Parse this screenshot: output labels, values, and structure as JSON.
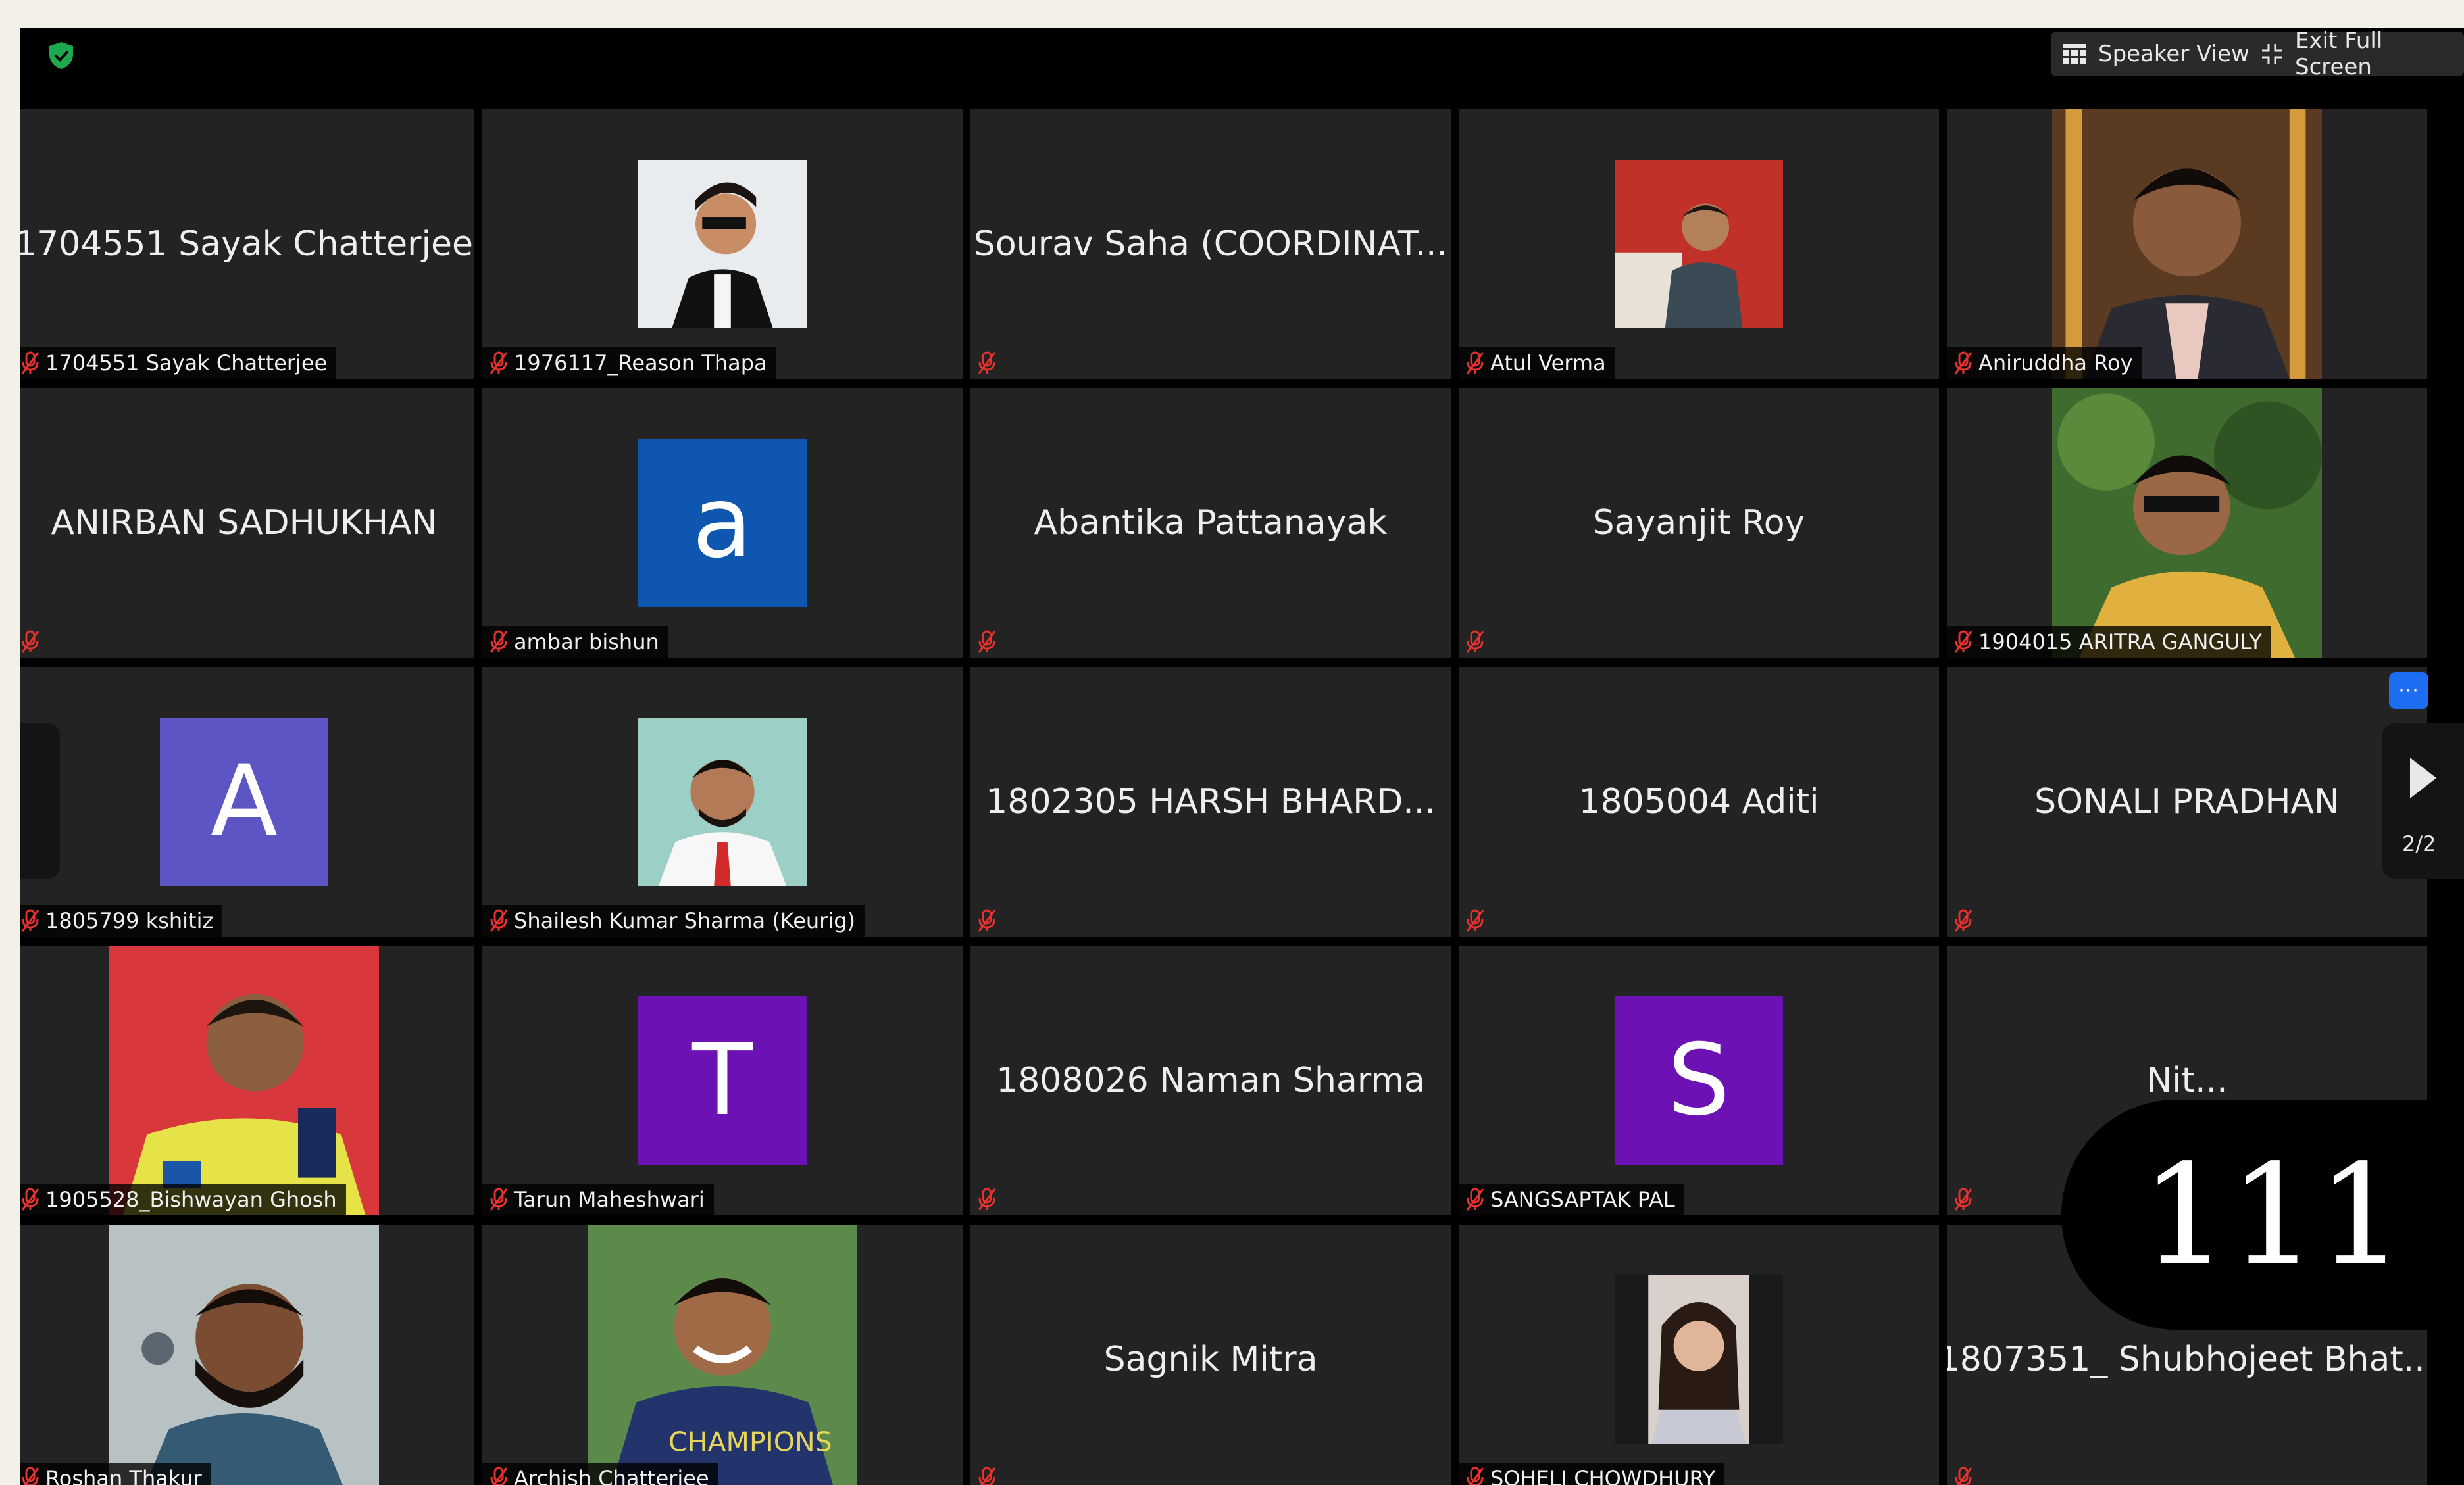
{
  "toolbar": {
    "speaker_view_label": "Speaker View",
    "exit_full_screen_label": "Exit Full Screen"
  },
  "pagination": {
    "page": "2/2"
  },
  "more_label": "···",
  "overlay": {
    "text": "111"
  },
  "colors": {
    "tile_bg": "#232323",
    "shield": "#1ea94f",
    "muted_mic": "#e8322f",
    "more_button": "#1c6df2"
  },
  "tiles": [
    {
      "display": "1704551 Sayak Chatterjee",
      "nameplate": "1704551 Sayak Chatterjee"
    },
    {
      "photo": "sunglasses-suit",
      "nameplate": "1976117_Reason Thapa"
    },
    {
      "display": "Sourav Saha (COORDINAT...",
      "nameplate": ""
    },
    {
      "photo": "man-red-room",
      "nameplate": "Atul Verma"
    },
    {
      "photo": "young-man-tie",
      "nameplate": "Aniruddha Roy"
    },
    {
      "display": "ANIRBAN SADHUKHAN",
      "nameplate": ""
    },
    {
      "letter": "a",
      "letter_bg": "#0f56b0",
      "nameplate": "ambar bishun"
    },
    {
      "display": "Abantika Pattanayak",
      "nameplate": ""
    },
    {
      "display": "Sayanjit Roy",
      "nameplate": ""
    },
    {
      "photo": "man-trees-sunglasses",
      "nameplate": "1904015 ARITRA GANGULY"
    },
    {
      "letter": "A",
      "letter_bg": "#5d55c4",
      "nameplate": "1805799 kshitiz"
    },
    {
      "photo": "man-white-shirt",
      "nameplate": "Shailesh Kumar Sharma (Keurig)"
    },
    {
      "display": "1802305 HARSH BHARD...",
      "nameplate": ""
    },
    {
      "display": "1805004 Aditi",
      "nameplate": ""
    },
    {
      "display": "SONALI PRADHAN",
      "nameplate": ""
    },
    {
      "photo": "cricketer-yellow",
      "nameplate": "1905528_Bishwayan Ghosh"
    },
    {
      "letter": "T",
      "letter_bg": "#6c12b5",
      "nameplate": "Tarun Maheshwari"
    },
    {
      "display": "1808026 Naman Sharma",
      "nameplate": ""
    },
    {
      "letter": "S",
      "letter_bg": "#6c12b5",
      "nameplate": "SANGSAPTAK PAL"
    },
    {
      "display": "Nit...",
      "nameplate": ""
    },
    {
      "photo": "bearded-man",
      "nameplate": "Roshan Thakur"
    },
    {
      "photo": "smiling-boy-blue",
      "nameplate": "Archish Chatterjee"
    },
    {
      "display": "Sagnik Mitra",
      "nameplate": ""
    },
    {
      "photo": "woman-portrait",
      "nameplate": "SOHELI CHOWDHURY"
    },
    {
      "display": "1807351_ Shubhojeet Bhat...",
      "nameplate": ""
    }
  ]
}
